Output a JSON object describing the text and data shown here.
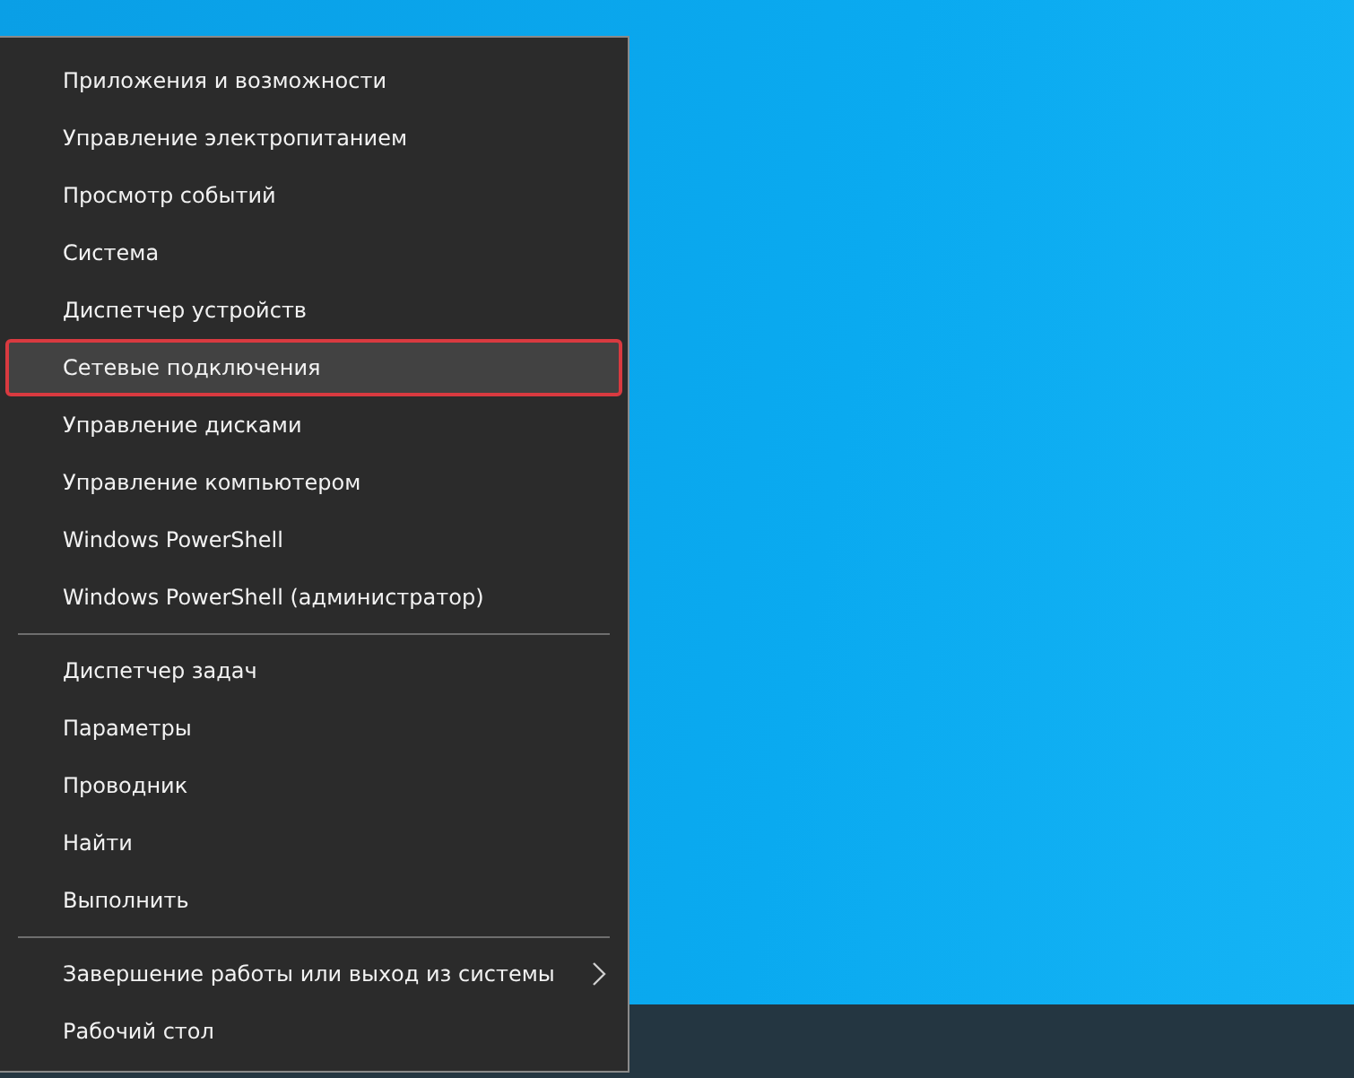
{
  "menu": {
    "groups": [
      {
        "items": [
          {
            "label": "Приложения и возможности",
            "selected": false,
            "kind": "plain"
          },
          {
            "label": "Управление электропитанием",
            "selected": false,
            "kind": "plain"
          },
          {
            "label": "Просмотр событий",
            "selected": false,
            "kind": "plain"
          },
          {
            "label": "Система",
            "selected": false,
            "kind": "plain"
          },
          {
            "label": "Диспетчер устройств",
            "selected": false,
            "kind": "plain"
          },
          {
            "label": "Сетевые подключения",
            "selected": true,
            "kind": "plain"
          },
          {
            "label": "Управление дисками",
            "selected": false,
            "kind": "plain"
          },
          {
            "label": "Управление компьютером",
            "selected": false,
            "kind": "plain"
          },
          {
            "label": "Windows PowerShell",
            "selected": false,
            "kind": "plain"
          },
          {
            "label": "Windows PowerShell (администратор)",
            "selected": false,
            "kind": "plain"
          }
        ]
      },
      {
        "items": [
          {
            "label": "Диспетчер задач",
            "selected": false,
            "kind": "plain"
          },
          {
            "label": "Параметры",
            "selected": false,
            "kind": "plain"
          },
          {
            "label": "Проводник",
            "selected": false,
            "kind": "plain"
          },
          {
            "label": "Найти",
            "selected": false,
            "kind": "plain"
          },
          {
            "label": "Выполнить",
            "selected": false,
            "kind": "plain"
          }
        ]
      },
      {
        "items": [
          {
            "label": "Завершение работы или выход из системы",
            "selected": false,
            "kind": "submenu"
          },
          {
            "label": "Рабочий стол",
            "selected": false,
            "kind": "plain"
          }
        ]
      }
    ]
  }
}
